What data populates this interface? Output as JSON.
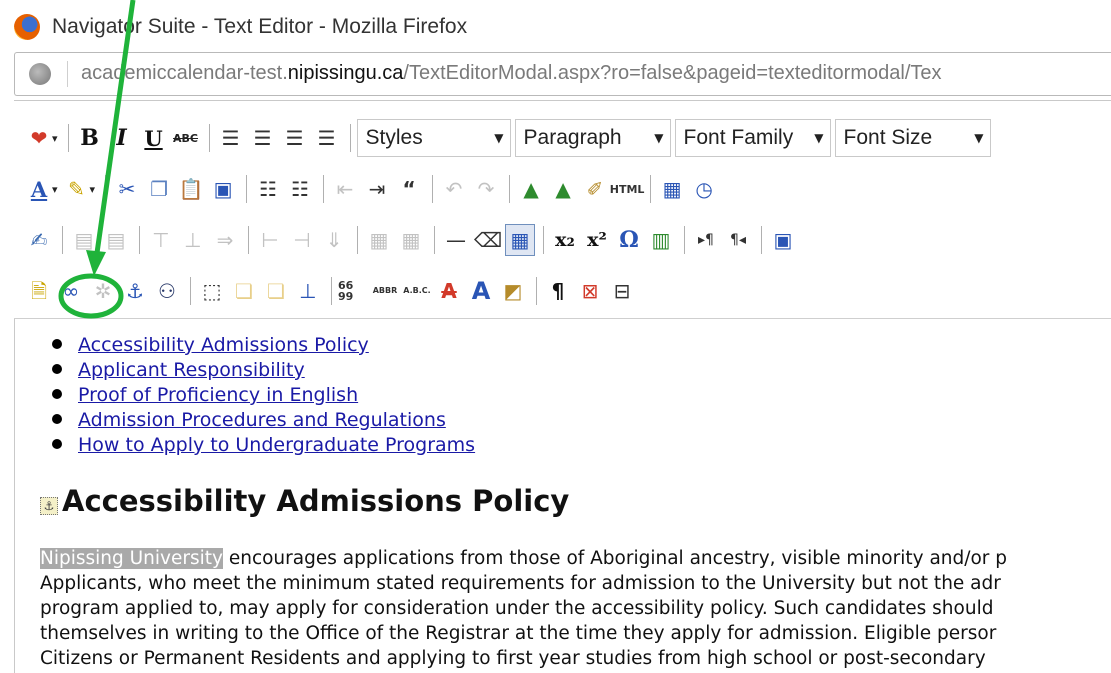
{
  "window": {
    "title": "Navigator Suite - Text Editor - Mozilla Firefox"
  },
  "address_bar": {
    "url_prefix": "academiccalendar-test.",
    "url_domain": "nipissingu.ca",
    "url_path": "/TextEditorModal.aspx?ro=false&pageid=texteditormodal/Tex"
  },
  "toolbar": {
    "styles_dropdown": "Styles",
    "paragraph_dropdown": "Paragraph",
    "font_family_dropdown": "Font Family",
    "font_size_dropdown": "Font Size",
    "bold_label": "B",
    "italic_label": "I",
    "underline_label": "U",
    "strikethrough_label": "ABC",
    "html_label": "HTML",
    "abbr_labels": {
      "quote": "66 99",
      "abbr": "ABBR",
      "acronym": "A.B.C."
    },
    "highlighted_tool": "insert-link"
  },
  "content": {
    "links": [
      "Accessibility Admissions Policy",
      "Applicant Responsibility",
      "Proof of Proficiency in English",
      "Admission Procedures and Regulations",
      "How to Apply to Undergraduate Programs"
    ],
    "heading": "Accessibility Admissions Policy",
    "paragraph_highlight": "Nipissing University",
    "paragraph_lines": [
      " encourages applications from those of Aboriginal ancestry, visible minority and/or p",
      "Applicants, who meet the minimum stated requirements for admission to the University but not the adr",
      "program applied to, may apply for consideration under the accessibility policy. Such candidates should",
      "themselves in writing to the Office of the Registrar at the time they apply for admission. Eligible persor",
      "Citizens or Permanent Residents and applying to first year studies from high school or post-secondary"
    ]
  },
  "colors": {
    "annotation_green": "#1fb33a",
    "link_blue": "#1a1aa6",
    "selection_gray": "#a9a9a9"
  }
}
